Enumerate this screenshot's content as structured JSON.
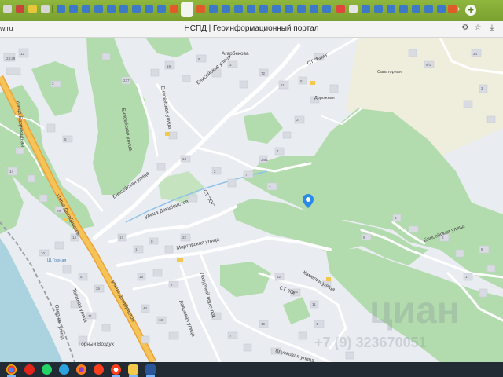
{
  "browser": {
    "address_fragment": "w.ru",
    "page_title": "НСПД | Геоинформационный портал",
    "new_tab_symbol": "+"
  },
  "map": {
    "streets": {
      "enisei_upper": "Енисейская улица",
      "enisei_mid": "Енисейская улица",
      "enisei_lower": "Енисейская улица",
      "enisei_east": "Енисейская улица",
      "dekabristov_main": "улица Декабристов",
      "dekabristov_ski": "улица Декабристов",
      "dekabristov_inner": "улица Декабристов",
      "martov": "Мартовская улица",
      "lazurny": "Лазурный переулок",
      "lavrovaya": "Лавровая улица",
      "kamelii": "Камелии улица",
      "brusovaya": "Брусковая улица",
      "tayozhnaya": "Таёжная улица",
      "barrikadnaya": "улица Баррикадная",
      "agrarenko": "Агарбекова",
      "st_yug": "СТ \"Юг\"",
      "st_yug2": "СТ \"Юг\"",
      "st_bryz": "СТ \"Бриз\"",
      "dorozhnaya": "Дорожная",
      "ozernaya": "Озерная улица",
      "gornyi_vozdukh": "Горный Воздух",
      "shakhe": "Ш.Горная",
      "sanatornaya": "Санаторная"
    },
    "parcels": [
      "23:49",
      "12",
      "3",
      "5",
      "14",
      "237",
      "19",
      "9",
      "3",
      "72",
      "11",
      "8",
      "1",
      "6/1",
      "24",
      "13",
      "2",
      "7",
      "34/1",
      "4",
      "7",
      "3",
      "29",
      "14",
      "10",
      "5",
      "26",
      "31",
      "17",
      "1",
      "9",
      "22",
      "15",
      "2",
      "44",
      "18",
      "6",
      "7",
      "32",
      "2",
      "11",
      "4",
      "46",
      "3",
      "6",
      "8",
      "1",
      "5",
      "3"
    ],
    "watermark_brand": "циан",
    "watermark_phone": "+7 (9) 323670051",
    "pin_color": "#2b8ae6"
  },
  "taskbar": {
    "apps": [
      {
        "icon": "chrome-icon"
      },
      {
        "icon": "opera-icon"
      },
      {
        "icon": "whatsapp-icon"
      },
      {
        "icon": "telegram-icon"
      },
      {
        "icon": "firefox-icon"
      },
      {
        "icon": "yandex-icon"
      },
      {
        "icon": "yandex-browser-icon"
      },
      {
        "icon": "explorer-icon"
      },
      {
        "icon": "word-icon"
      }
    ]
  }
}
